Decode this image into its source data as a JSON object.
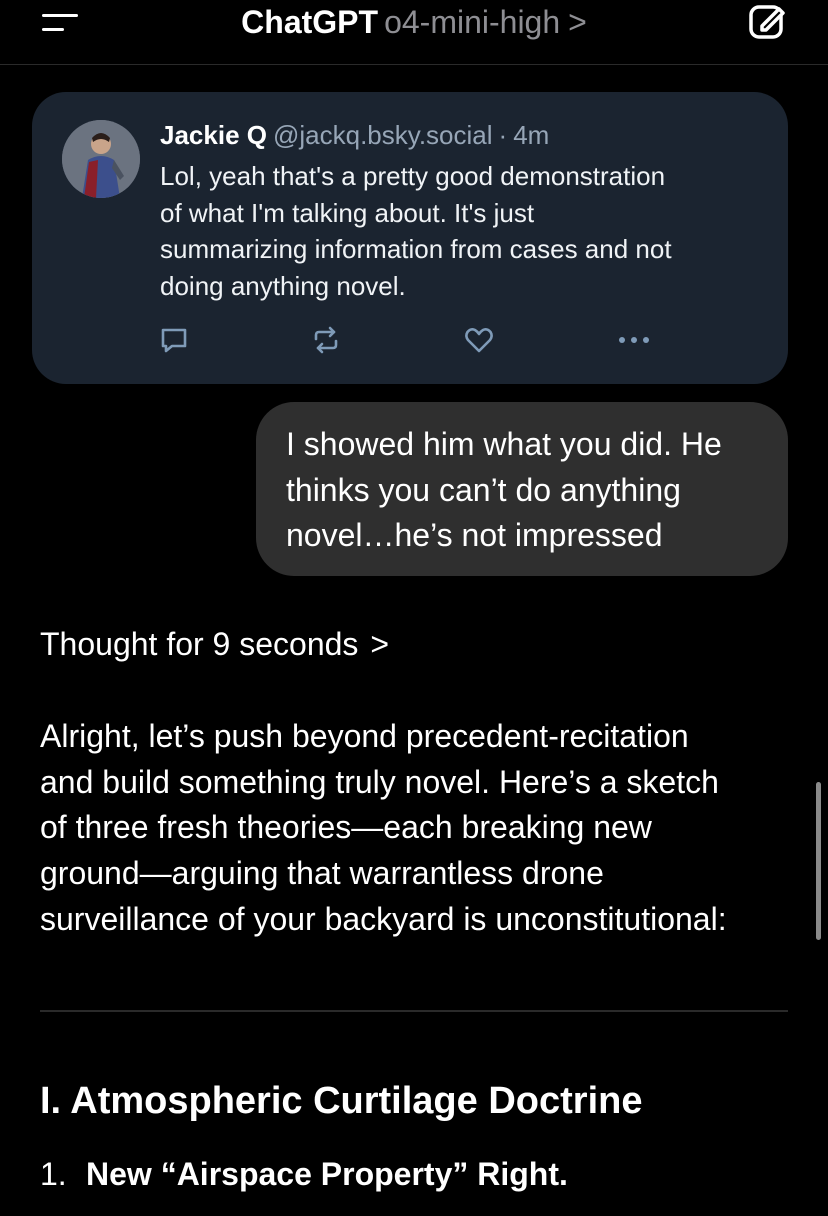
{
  "header": {
    "app_name": "ChatGPT",
    "model": "o4-mini-high",
    "model_chevron": ">",
    "menu_icon": "hamburger-menu-icon",
    "new_chat_icon": "edit-icon"
  },
  "post": {
    "author_name": "Jackie Q",
    "handle": "@jackq.bsky.social",
    "separator": "·",
    "time_ago": "4m",
    "text_lines": [
      "Lol, yeah that's a pretty good demonstration",
      "of what I'm talking about. It's just",
      "summarizing information from cases and not",
      "doing anything novel."
    ],
    "actions": [
      "reply-icon",
      "repost-icon",
      "like-icon",
      "more-icon"
    ]
  },
  "user_message": {
    "lines": [
      "I showed him what you did. He",
      "thinks you can’t do anything",
      "novel…he’s not impressed"
    ]
  },
  "thought": {
    "label": "Thought for 9 seconds",
    "chevron": ">"
  },
  "assistant": {
    "lines": [
      "Alright, let’s push beyond precedent-recitation",
      "and build something truly novel. Here’s a sketch",
      "of three fresh theories—each breaking new",
      "ground—arguing that warrantless drone",
      "surveillance of your backyard is unconstitutional:"
    ],
    "section_heading": "I. Atmospheric Curtilage Doctrine",
    "list": [
      {
        "number": "1.",
        "text": "New “Airspace Property” Right."
      }
    ]
  },
  "colors": {
    "background": "#000000",
    "card_background": "#1b2430",
    "bubble_background": "#2f2f2f",
    "muted_text": "#8e8e93",
    "handle_text": "#97a6b7"
  }
}
